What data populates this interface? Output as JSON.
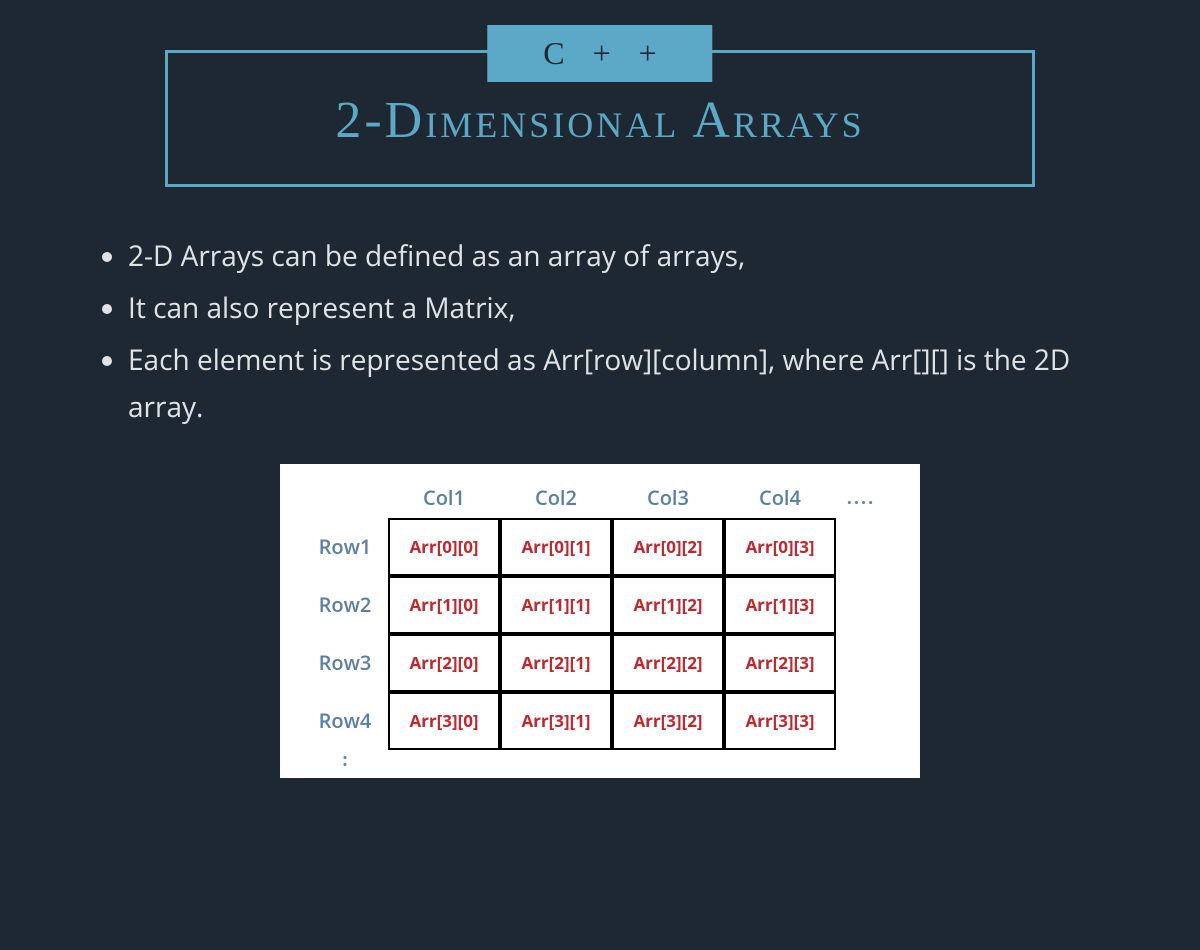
{
  "header": {
    "badge": "C + +",
    "title": "2-Dimensional Arrays"
  },
  "bullets": [
    "2-D Arrays can be defined as an array of arrays,",
    "It can also represent a Matrix,",
    "Each element is represented as Arr[row][column], where Arr[][] is the 2D array."
  ],
  "matrix": {
    "col_headers": [
      "Col1",
      "Col2",
      "Col3",
      "Col4"
    ],
    "col_ellipsis": "....",
    "row_headers": [
      "Row1",
      "Row2",
      "Row3",
      "Row4"
    ],
    "row_ellipsis": ":",
    "cells": [
      [
        "Arr[0][0]",
        "Arr[0][1]",
        "Arr[0][2]",
        "Arr[0][3]"
      ],
      [
        "Arr[1][0]",
        "Arr[1][1]",
        "Arr[1][2]",
        "Arr[1][3]"
      ],
      [
        "Arr[2][0]",
        "Arr[2][1]",
        "Arr[2][2]",
        "Arr[2][3]"
      ],
      [
        "Arr[3][0]",
        "Arr[3][1]",
        "Arr[3][2]",
        "Arr[3][3]"
      ]
    ]
  }
}
